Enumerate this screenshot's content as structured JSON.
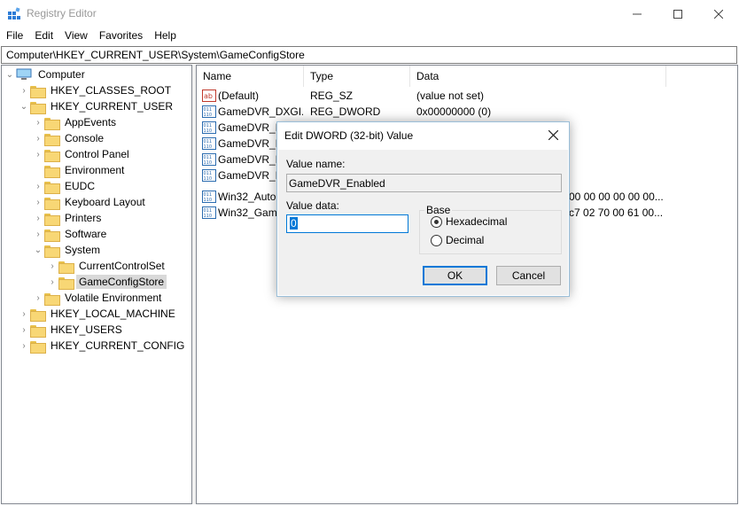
{
  "window": {
    "title": "Registry Editor",
    "minimize": "—",
    "maximize": "☐",
    "close": "✕"
  },
  "menu": [
    "File",
    "Edit",
    "View",
    "Favorites",
    "Help"
  ],
  "address": "Computer\\HKEY_CURRENT_USER\\System\\GameConfigStore",
  "tree": [
    {
      "label": "Computer",
      "expander": "⌄",
      "icon": "computer-icon"
    },
    {
      "label": "HKEY_CLASSES_ROOT",
      "expander": "›"
    },
    {
      "label": "HKEY_CURRENT_USER",
      "expander": "⌄"
    },
    {
      "label": "AppEvents",
      "expander": "›"
    },
    {
      "label": "Console",
      "expander": "›"
    },
    {
      "label": "Control Panel",
      "expander": "›"
    },
    {
      "label": "Environment",
      "expander": ""
    },
    {
      "label": "EUDC",
      "expander": "›"
    },
    {
      "label": "Keyboard Layout",
      "expander": "›"
    },
    {
      "label": "Printers",
      "expander": "›"
    },
    {
      "label": "Software",
      "expander": "›"
    },
    {
      "label": "System",
      "expander": "⌄"
    },
    {
      "label": "CurrentControlSet",
      "expander": "›"
    },
    {
      "label": "GameConfigStore",
      "expander": "›",
      "selected": true
    },
    {
      "label": "Volatile Environment",
      "expander": "›"
    },
    {
      "label": "HKEY_LOCAL_MACHINE",
      "expander": "›"
    },
    {
      "label": "HKEY_USERS",
      "expander": "›"
    },
    {
      "label": "HKEY_CURRENT_CONFIG",
      "expander": "›"
    }
  ],
  "list": {
    "columns": [
      "Name",
      "Type",
      "Data"
    ],
    "rows": [
      {
        "name": "(Default)",
        "type": "REG_SZ",
        "data": "(value not set)",
        "icon": "string-value-icon"
      },
      {
        "name": "GameDVR_DXGI...",
        "type": "REG_DWORD",
        "data": "0x00000000 (0)",
        "icon": "binary-value-icon"
      },
      {
        "name": "GameDVR_EF",
        "type": "",
        "data": "",
        "icon": "binary-value-icon"
      },
      {
        "name": "GameDVR_Er",
        "type": "",
        "data": "",
        "icon": "binary-value-icon"
      },
      {
        "name": "GameDVR_FS",
        "type": "",
        "data": "",
        "icon": "binary-value-icon"
      },
      {
        "name": "GameDVR_H",
        "type": "",
        "data": "",
        "icon": "binary-value-icon"
      },
      {
        "name": "Win32_AutoG",
        "type": "",
        "data": "0 00 00 00 00 00 00...",
        "icon": "binary-value-icon"
      },
      {
        "name": "Win32_Game",
        "type": "",
        "data": "4 c7 02 70 00 61 00...",
        "icon": "binary-value-icon"
      }
    ]
  },
  "dialog": {
    "title": "Edit DWORD (32-bit) Value",
    "close": "✕",
    "value_name_label": "Value name:",
    "value_name": "GameDVR_Enabled",
    "value_data_label": "Value data:",
    "value_data": "0",
    "base_label": "Base",
    "hex_label": "Hexadecimal",
    "dec_label": "Decimal",
    "ok": "OK",
    "cancel": "Cancel"
  }
}
